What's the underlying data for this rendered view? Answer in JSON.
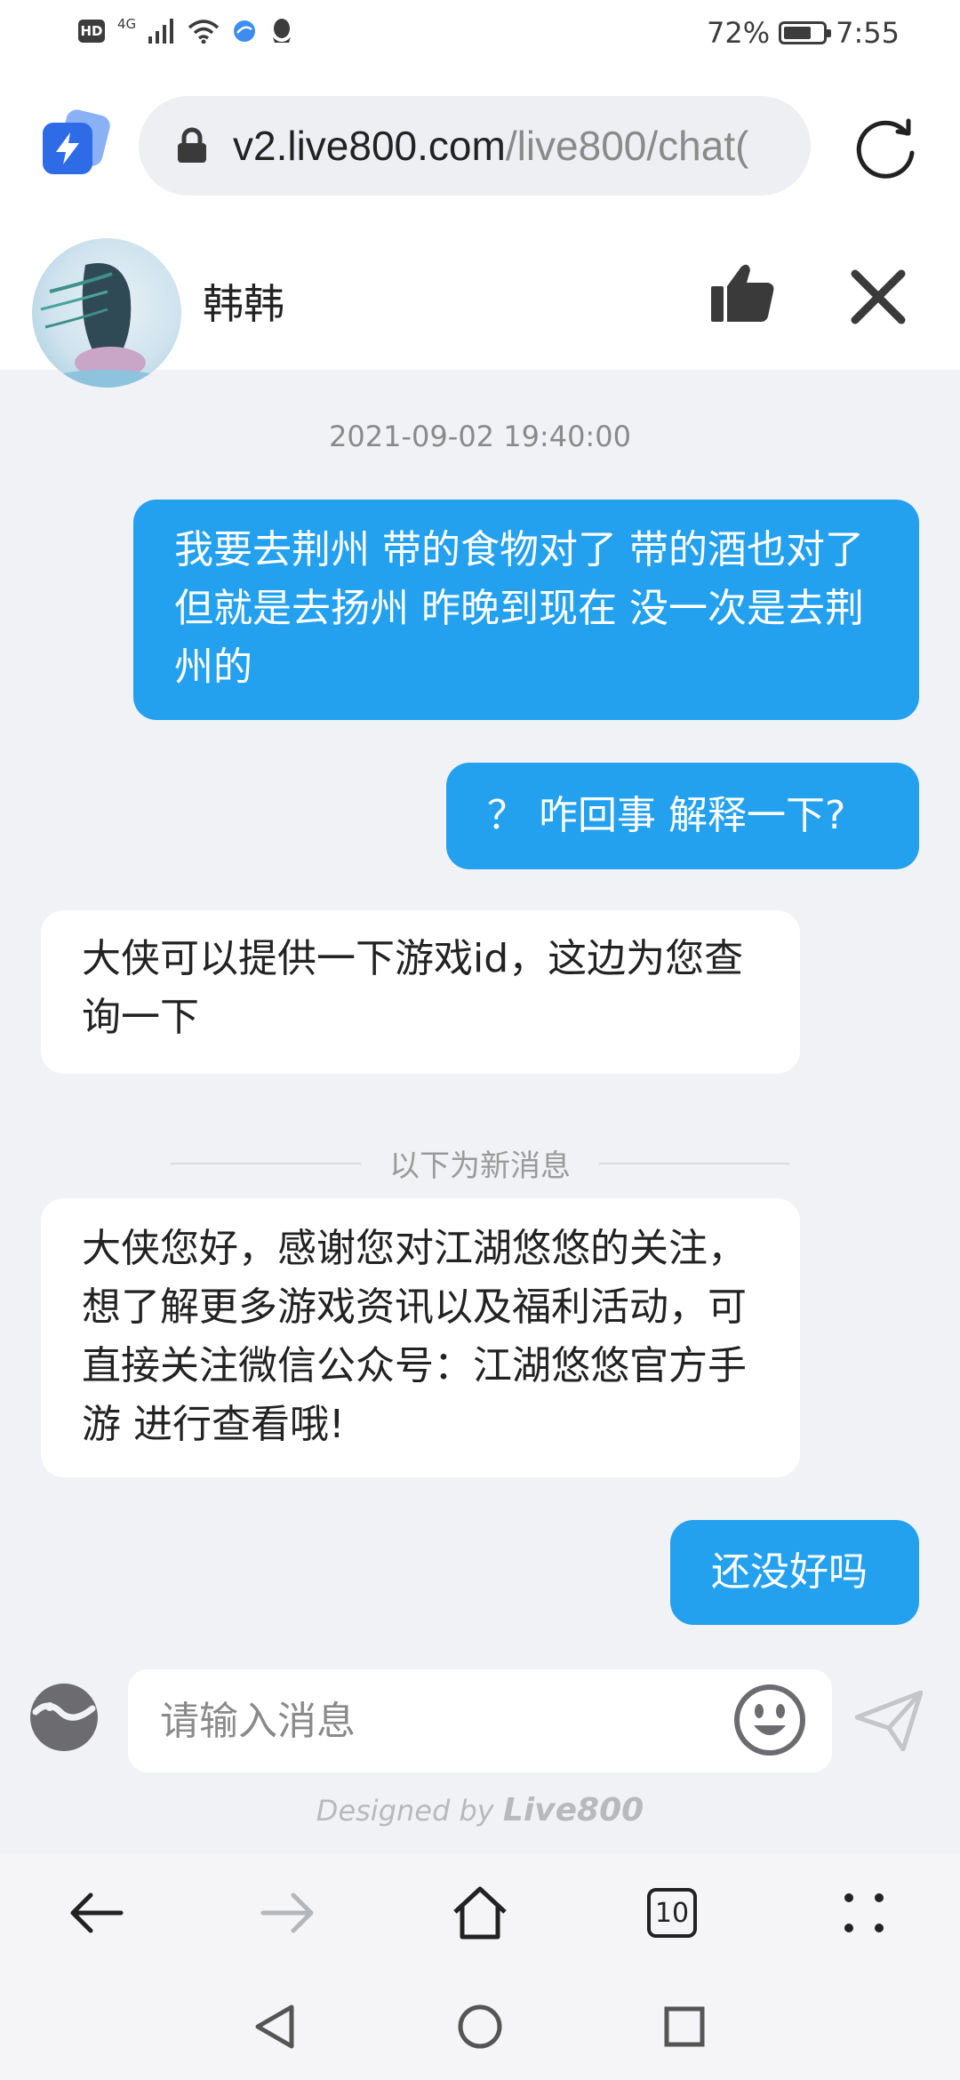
{
  "status_bar": {
    "hd": "HD",
    "network": "4G",
    "battery_percent": "72%",
    "battery_level": 0.72,
    "time": "7:55",
    "icons": [
      "hd-icon",
      "signal-icon",
      "wifi-icon",
      "browser-app-icon",
      "qq-icon",
      "battery-icon"
    ]
  },
  "browser": {
    "url_host": "v2.live800.com",
    "url_path": "/live800/chat("
  },
  "chat_header": {
    "agent_name": "韩韩"
  },
  "chat": {
    "timestamp": "2021-09-02 19:40:00",
    "messages": [
      {
        "from": "user",
        "text": "我要去荆州 带的食物对了 带的酒也对了 但就是去扬州 昨晚到现在 没一次是去荆州的"
      },
      {
        "from": "user",
        "text": "？ 咋回事 解释一下?"
      },
      {
        "from": "agent",
        "text": "大侠可以提供一下游戏id，这边为您查询一下"
      },
      {
        "from": "agent",
        "text": "大侠您好，感谢您对江湖悠悠的关注，想了解更多游戏资讯以及福利活动，可直接关注微信公众号：江湖悠悠官方手游 进行查看哦!"
      },
      {
        "from": "user",
        "text": "还没好吗"
      }
    ],
    "new_messages_divider": "以下为新消息"
  },
  "input": {
    "placeholder": "请输入消息",
    "value": ""
  },
  "footer": {
    "designed_by_prefix": "Designed by ",
    "designed_by_brand": "Live800"
  },
  "browser_nav": {
    "tab_count": "10"
  },
  "colors": {
    "outgoing_bubble": "#23a0ee",
    "incoming_bubble": "#ffffff",
    "chat_background": "#f1f2f5",
    "accent_blue": "#2e6be6"
  }
}
